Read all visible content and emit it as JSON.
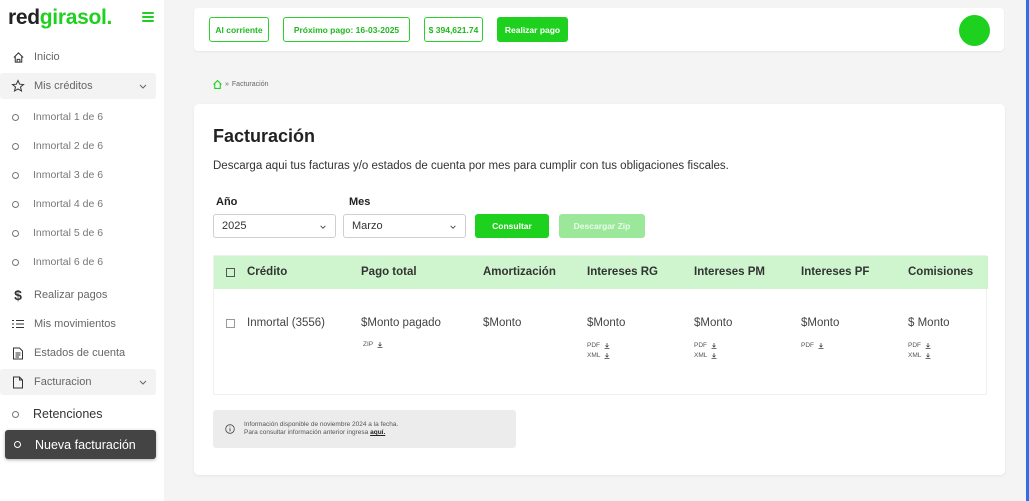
{
  "brand": {
    "part1": "red",
    "part2": "girasol",
    "dot": "."
  },
  "sidebar": {
    "inicio": "Inicio",
    "mis_creditos": "Mis créditos",
    "creditos": [
      "Inmortal 1 de 6",
      "Inmortal 2 de 6",
      "Inmortal 3 de 6",
      "Inmortal 4 de 6",
      "Inmortal 5 de 6",
      "Inmortal 6 de 6"
    ],
    "realizar_pagos": "Realizar pagos",
    "mis_movimientos": "Mis movimientos",
    "estados_cuenta": "Estados de cuenta",
    "facturacion": "Facturacion",
    "retenciones": "Retenciones",
    "nueva_facturacion": "Nueva facturación"
  },
  "topbar": {
    "status": "Al corriente",
    "next_payment": "Próximo pago: 16-03-2025",
    "amount": "$ 394,621.74",
    "pay_button": "Realizar pago"
  },
  "breadcrumb": {
    "separator": "»",
    "current": "Facturación"
  },
  "page": {
    "title": "Facturación",
    "description": "Descarga aqui tus facturas y/o estados de cuenta por mes para cumplir con tus obligaciones fiscales.",
    "year_label": "Año",
    "year_value": "2025",
    "month_label": "Mes",
    "month_value": "Marzo",
    "consult_button": "Consultar",
    "zip_button": "Descargar Zip"
  },
  "table": {
    "headers": [
      "Crédito",
      "Pago total",
      "Amortización",
      "Intereses RG",
      "Intereses PM",
      "Intereses PF",
      "Comisiones"
    ],
    "row": {
      "credito": "Inmortal (3556)",
      "pago_total": "$Monto pagado",
      "amortizacion": "$Monto",
      "intereses_rg": "$Monto",
      "intereses_pm": "$Monto",
      "intereses_pf": "$Monto",
      "comisiones": "$ Monto",
      "zip": "ZIP",
      "pdf": "PDF",
      "xml": "XML"
    }
  },
  "info": {
    "line1": "Información disponible de noviembre 2024 a la fecha.",
    "line2": "Para consultar información anterior ingresa",
    "link": "aquí."
  },
  "colors": {
    "accent": "#1fd11f",
    "active_bg": "#444444",
    "table_header": "#cef5ce"
  }
}
